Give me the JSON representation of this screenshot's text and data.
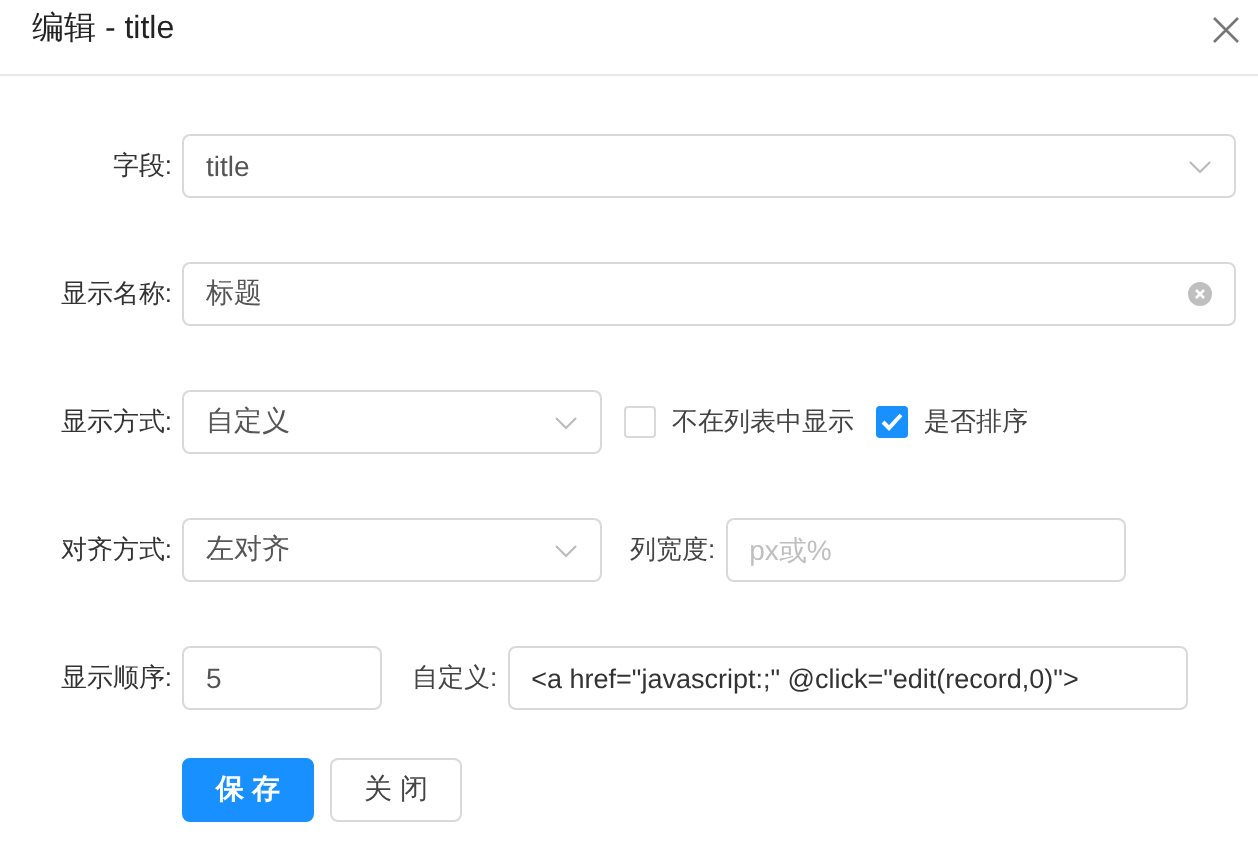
{
  "window": {
    "title": "编辑 - title"
  },
  "form": {
    "field": {
      "label": "字段:",
      "value": "title"
    },
    "display_name": {
      "label": "显示名称:",
      "value": "标题"
    },
    "display_mode": {
      "label": "显示方式:",
      "value": "自定义"
    },
    "checkboxes": [
      {
        "label": "不在列表中显示",
        "checked": false
      },
      {
        "label": "是否排序",
        "checked": true
      }
    ],
    "align": {
      "label": "对齐方式:",
      "value": "左对齐"
    },
    "column_width": {
      "label": "列宽度:",
      "placeholder": "px或%"
    },
    "order": {
      "label": "显示顺序:",
      "value": "5"
    },
    "custom": {
      "label": "自定义:",
      "value": "<a href=\"javascript:;\" @click=\"edit(record,0)\">"
    }
  },
  "buttons": [
    {
      "label": "保 存",
      "kind": "primary"
    },
    {
      "label": "关 闭",
      "kind": "default"
    }
  ]
}
